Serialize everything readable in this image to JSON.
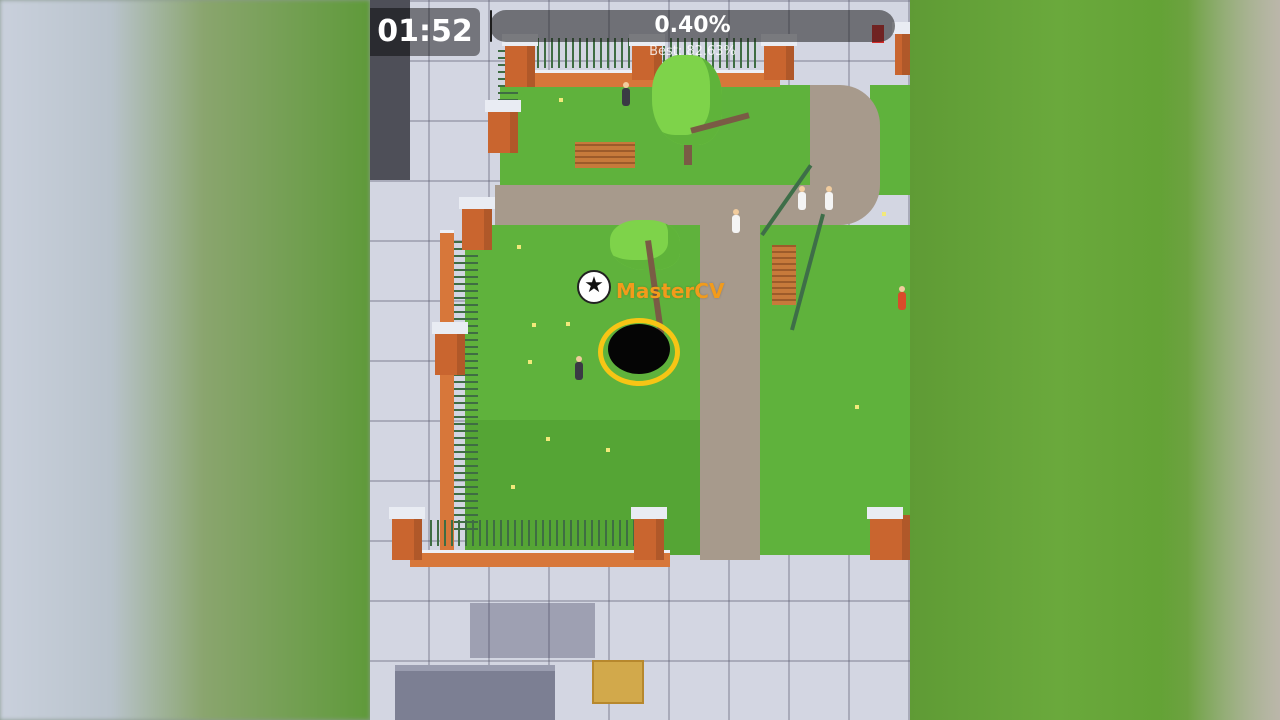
{
  "hud": {
    "timer": "01:52",
    "progress_label": "0.40%",
    "progress_fraction": 0.004,
    "best_label": "Best: 82.63%"
  },
  "player": {
    "name": "MasterCV",
    "badge_icon": "soccer-ball-icon"
  },
  "colors": {
    "grass": "#5fb23c",
    "hole_ring": "#f7c515",
    "player_name": "#f29b1b",
    "brick": "#d7773a"
  }
}
